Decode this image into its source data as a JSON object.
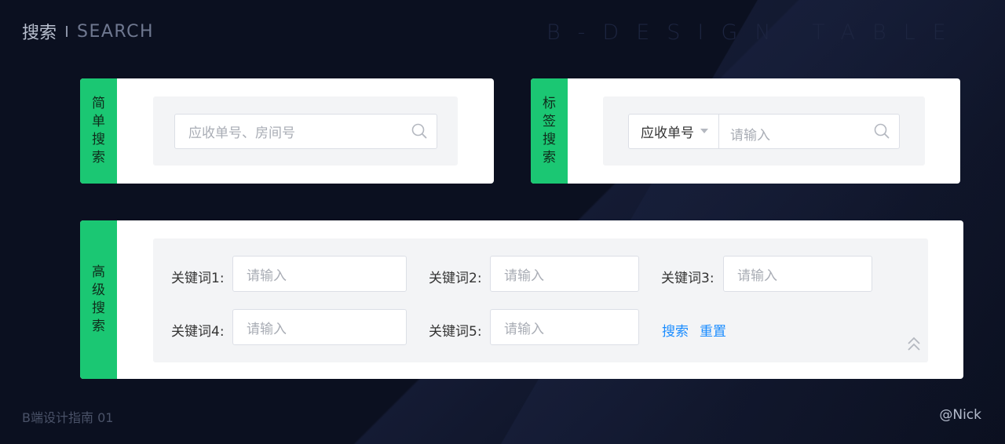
{
  "header": {
    "title_cn": "搜索",
    "title_en": "SEARCH",
    "watermark": "B-DESIGN TABLE"
  },
  "simple_search": {
    "tag": [
      "简",
      "单",
      "搜",
      "索"
    ],
    "placeholder": "应收单号、房间号"
  },
  "tag_search": {
    "tag": [
      "标",
      "签",
      "搜",
      "索"
    ],
    "select_value": "应收单号",
    "placeholder": "请输入"
  },
  "advanced_search": {
    "tag": [
      "高",
      "级",
      "搜",
      "索"
    ],
    "fields": [
      {
        "label": "关键词1:",
        "placeholder": "请输入"
      },
      {
        "label": "关键词2:",
        "placeholder": "请输入"
      },
      {
        "label": "关键词3:",
        "placeholder": "请输入"
      },
      {
        "label": "关键词4:",
        "placeholder": "请输入"
      },
      {
        "label": "关键词5:",
        "placeholder": "请输入"
      }
    ],
    "search_label": "搜索",
    "reset_label": "重置",
    "collapse_icon": "double-chevron-up-icon"
  },
  "footer": {
    "left": "B端设计指南 01",
    "right": "@Nick"
  },
  "colors": {
    "accent_green": "#1bc773",
    "link_blue": "#1a8cff",
    "background": "#0b1020"
  }
}
